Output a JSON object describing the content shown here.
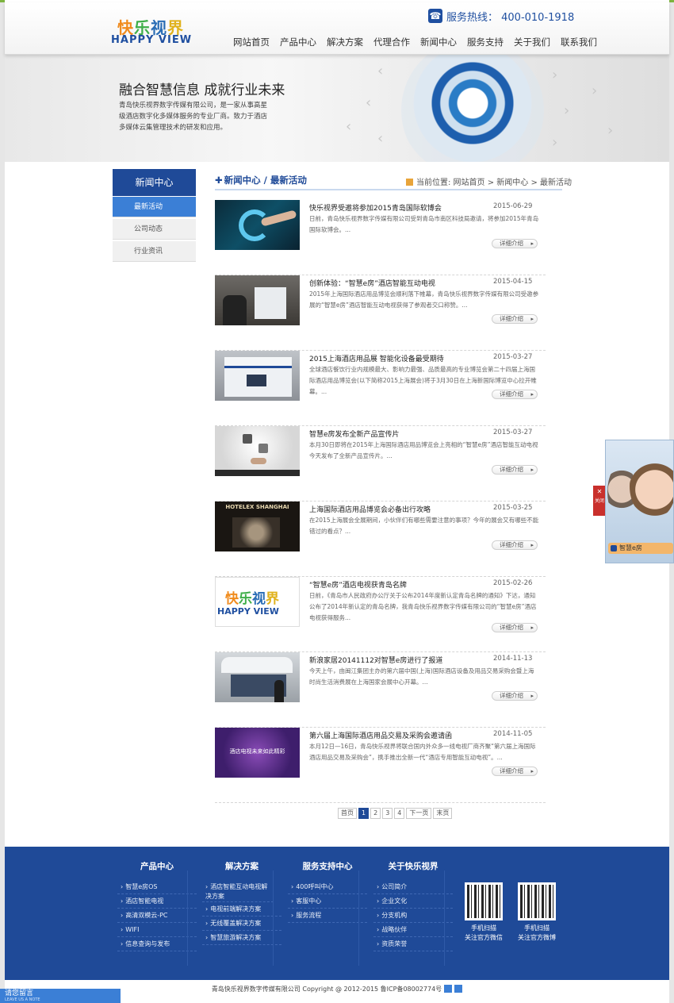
{
  "header": {
    "logo_cn": [
      "快",
      "乐",
      "视",
      "界"
    ],
    "logo_en": "HAPPY VIEW",
    "hotline": "服务热线： 400-010-1918",
    "nav": [
      "网站首页",
      "产品中心",
      "解决方案",
      "代理合作",
      "新闻中心",
      "服务支持",
      "关于我们",
      "联系我们"
    ]
  },
  "banner": {
    "title": "融合智慧信息  成就行业未来",
    "desc": "青岛快乐视界数字传媒有限公司，是一家从事高星级酒店数字化多媒体服务的专业厂商。致力于酒店多媒体云集管理技术的研发和应用。"
  },
  "sidebar": {
    "title": "新闻中心",
    "items": [
      "最新活动",
      "公司动态",
      "行业资讯"
    ],
    "active_index": 0
  },
  "content": {
    "title": "新闻中心 / 最新活动",
    "breadcrumb": "当前位置: 网站首页 > 新闻中心 > 最新活动"
  },
  "news": [
    {
      "title": "快乐视界受邀将参加2015青岛国际软博会",
      "date": "2015-06-29",
      "desc": "日前，青岛快乐视界数字传媒有限公司受到青岛市南区科技局邀请，将参加2015年青岛国际软博会。...",
      "more": "详细介绍",
      "thumb": "thumb-hand-e"
    },
    {
      "title": "创新体验：“智慧e房”酒店智能互动电视",
      "date": "2015-04-15",
      "desc": "2015年上海国际酒店用品博览会顺利落下帷幕，青岛快乐视界数字传媒有限公司受邀参展的“智慧e房”酒店智能互动电视获得了参观者交口称赞。...",
      "more": "详细介绍",
      "thumb": "thumb-expo-crowd"
    },
    {
      "title": "2015上海酒店用品展 智能化设备最受期待",
      "date": "2015-03-27",
      "desc": "全球酒店餐饮行业内规模最大、影响力最强、品质最高的专业博览会第二十四届上海国际酒店用品博览会(以下简称2015上海展会)将于3月30日在上海新国际博览中心拉开帷幕。...",
      "more": "详细介绍",
      "thumb": "thumb-booth"
    },
    {
      "title": "智慧e房发布全新产品宣传片",
      "date": "2015-03-27",
      "desc": "本月30日即将在2015年上海国际酒店用品博览会上亮相的“智慧e房”酒店智能互动电视今天发布了全新产品宣传片。...",
      "more": "详细介绍",
      "thumb": "thumb-video"
    },
    {
      "title": "上海国际酒店用品博览会必备出行攻略",
      "date": "2015-03-25",
      "desc": "在2015上海展会全展期间，小伙伴们有哪些需要注意的事项？今年的展会又有哪些不能错过的看点？...",
      "more": "详细介绍",
      "thumb": "thumb-hotelex",
      "thumb_text": "HOTELEX SHANGHAI"
    },
    {
      "title": "“智慧e房”酒店电视获青岛名牌",
      "date": "2015-02-26",
      "desc": "日前，《青岛市人民政府办公厅关于公布2014年度新认定青岛名牌的通知》下达，通知公布了2014年新认定的青岛名牌，我青岛快乐视界数字传媒有限公司的“智慧e房”酒店电视获得服务...",
      "more": "详细介绍",
      "thumb": "thumb-logo"
    },
    {
      "title": "新浪家居20141112对智慧e房进行了报道",
      "date": "2014-11-13",
      "desc": "今天上午，由闽江集团主办的第六届中国(上海)国际酒店设备及用品交易采购会暨上海时尚生活消费展在上海国家会展中心开幕。...",
      "more": "详细介绍",
      "thumb": "thumb-exhibition"
    },
    {
      "title": "第六届上海国际酒店用品交易及采购会邀请函",
      "date": "2014-11-05",
      "desc": "本月12日—16日，青岛快乐视界将联合国内外众多一线电视厂商齐聚“第六届上海国际酒店用品交易及采购会”，携手推出全新一代“酒店专用智能互动电视”。...",
      "more": "详细介绍",
      "thumb": "thumb-invite",
      "thumb_text": "酒店电视未来如此精彩"
    }
  ],
  "pager": {
    "first": "首页",
    "pages": [
      "1",
      "2",
      "3",
      "4"
    ],
    "current": "1",
    "next": "下一页",
    "last": "末页"
  },
  "footer": {
    "columns": [
      {
        "title": "产品中心",
        "items": [
          "智慧e房OS",
          "酒店智能电视",
          "高清双模云-PC",
          "WIFI",
          "信息查询与发布"
        ]
      },
      {
        "title": "解决方案",
        "items": [
          "酒店智能互动电视解决方案",
          "电视前端解决方案",
          "无线覆盖解决方案",
          "智慧旅游解决方案"
        ]
      },
      {
        "title": "服务支持中心",
        "items": [
          "400呼叫中心",
          "客服中心",
          "服务流程"
        ]
      },
      {
        "title": "关于快乐视界",
        "items": [
          "公司简介",
          "企业文化",
          "分支机构",
          "战略伙伴",
          "资质荣誉"
        ]
      }
    ],
    "qr": [
      {
        "caption_1": "手机扫描",
        "caption_2": "关注官方微信"
      },
      {
        "caption_1": "手机扫描",
        "caption_2": "关注官方微博"
      }
    ],
    "copyright": "青岛快乐视界数字传媒有限公司 Copyright @ 2012-2015 鲁ICP备08002774号"
  },
  "message_bar": {
    "label": "请您留言",
    "sub": "LEAVE US A NOTE"
  },
  "float": {
    "label": "智慧e房",
    "close": "关闭"
  },
  "colors": {
    "brand": "#1f4a98",
    "accent": "#3b7fd6",
    "green": "#7db33f"
  }
}
